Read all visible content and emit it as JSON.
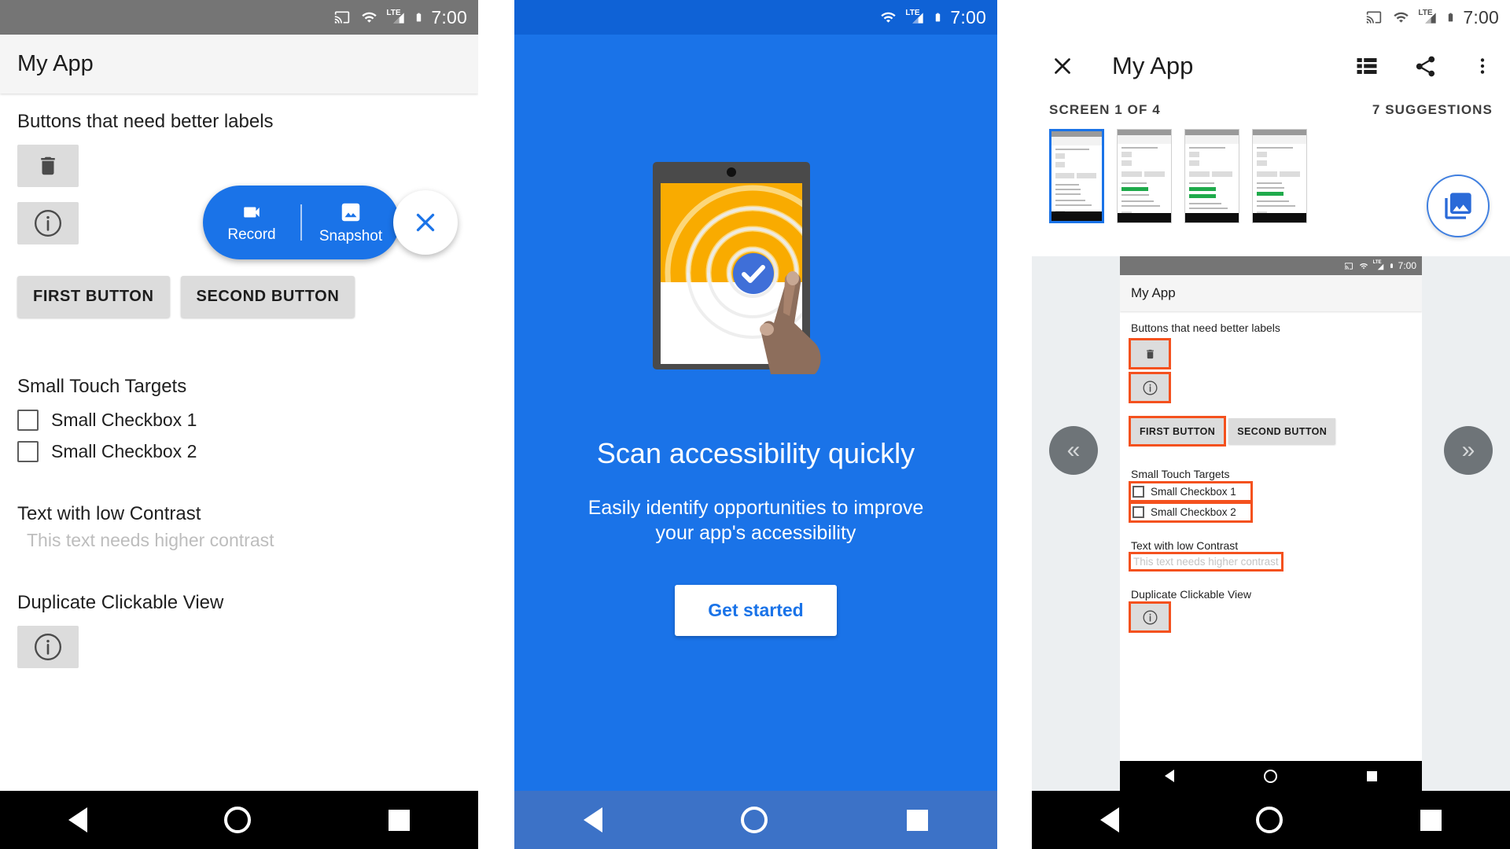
{
  "status_bar": {
    "time": "7:00",
    "icons": [
      "cast-icon",
      "wifi-icon",
      "lte-signal-icon",
      "battery-icon"
    ]
  },
  "left_panel": {
    "app_bar": {
      "title": "My App"
    },
    "sections": [
      {
        "label": "Buttons that need better labels"
      },
      {
        "label": "Small Touch Targets"
      },
      {
        "label": "Text with low Contrast"
      },
      {
        "label": "Duplicate Clickable View"
      }
    ],
    "icon_buttons": [
      {
        "name": "delete-icon-button",
        "icon": "trash-icon"
      },
      {
        "name": "info-icon-button",
        "icon": "info-circle-icon"
      }
    ],
    "buttons": [
      {
        "label": "FIRST BUTTON"
      },
      {
        "label": "SECOND BUTTON"
      }
    ],
    "checkboxes": [
      {
        "label": "Small Checkbox 1",
        "checked": false
      },
      {
        "label": "Small Checkbox 2",
        "checked": false
      }
    ],
    "low_contrast_text": "This text needs higher contrast",
    "duplicate_icon": "info-circle-icon",
    "floating_widget": {
      "record_label": "Record",
      "record_icon": "video-camera-icon",
      "snapshot_label": "Snapshot",
      "snapshot_icon": "image-icon",
      "close_icon": "close-icon",
      "accent_color": "#1a73e8"
    }
  },
  "middle_panel": {
    "headline": "Scan accessibility quickly",
    "subtitle": "Easily identify opportunities to improve your app's accessibility",
    "cta_label": "Get started",
    "illustration": "tablet-scan-tap-illustration",
    "background_color": "#1a73e8",
    "status_time": "7:00"
  },
  "right_panel": {
    "app_bar": {
      "close_icon": "close-icon",
      "title": "My App",
      "actions": [
        "list-view-icon",
        "share-icon",
        "overflow-menu-icon"
      ]
    },
    "meta": {
      "screen_counter": "SCREEN 1 OF 4",
      "suggestion_count": "7 SUGGESTIONS"
    },
    "thumbnails": [
      {
        "label": "screen-1",
        "selected": true
      },
      {
        "label": "screen-2",
        "selected": false
      },
      {
        "label": "screen-3",
        "selected": false
      },
      {
        "label": "screen-4",
        "selected": false
      }
    ],
    "gallery_fab_icon": "gallery-icon",
    "prev_arrow": "«",
    "next_arrow": "»",
    "preview": {
      "status_time": "7:00",
      "app_bar_title": "My App",
      "sections": [
        {
          "label": "Buttons that need better labels"
        },
        {
          "label": "Small Touch Targets"
        },
        {
          "label": "Text with low Contrast"
        },
        {
          "label": "Duplicate Clickable View"
        }
      ],
      "buttons": [
        {
          "label": "FIRST BUTTON",
          "highlighted": true
        },
        {
          "label": "SECOND BUTTON",
          "highlighted": false
        }
      ],
      "checkboxes": [
        {
          "label": "Small Checkbox 1",
          "highlighted": true
        },
        {
          "label": "Small Checkbox 2",
          "highlighted": true
        }
      ],
      "low_contrast_text": "This text needs higher contrast",
      "highlight_color": "#f4511e"
    }
  }
}
